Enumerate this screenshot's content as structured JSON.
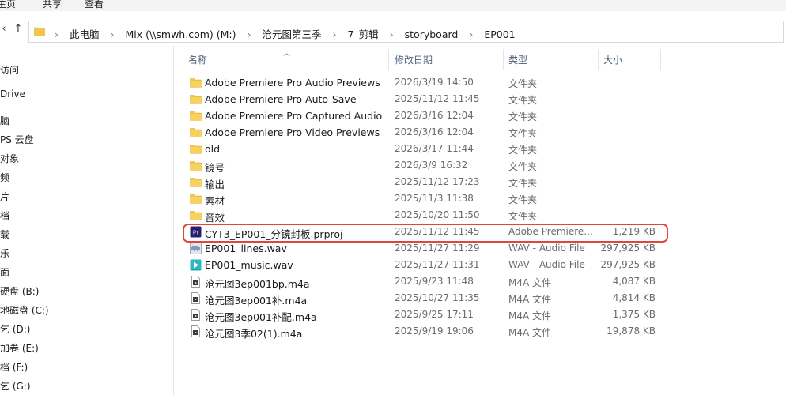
{
  "ribbon": {
    "tabs": [
      "主页",
      "共享",
      "查看"
    ]
  },
  "nav": {
    "back": "‹",
    "up": "↑"
  },
  "address": {
    "crumbs": [
      "此电脑",
      "Mix (\\\\smwh.com) (M:)",
      "沧元图第三季",
      "7_剪辑",
      "storyboard",
      "EP001"
    ],
    "separator": "›"
  },
  "sidebar": {
    "items": [
      "访问",
      "Drive",
      "脑",
      "PS 云盘",
      "对象",
      "频",
      "片",
      "档",
      "载",
      "乐",
      "面",
      "硬盘 (B:)",
      "地磁盘 (C:)",
      "乞 (D:)",
      "加卷 (E:)",
      "档 (F:)",
      "乞 (G:)"
    ]
  },
  "columns": {
    "name": "名称",
    "date": "修改日期",
    "type": "类型",
    "size": "大小"
  },
  "files": [
    {
      "icon": "folder",
      "name": "Adobe Premiere Pro Audio Previews",
      "date": "2026/3/19 14:50",
      "type": "文件夹",
      "size": ""
    },
    {
      "icon": "folder",
      "name": "Adobe Premiere Pro Auto-Save",
      "date": "2025/11/12 11:45",
      "type": "文件夹",
      "size": ""
    },
    {
      "icon": "folder",
      "name": "Adobe Premiere Pro Captured Audio",
      "date": "2026/3/16 12:04",
      "type": "文件夹",
      "size": ""
    },
    {
      "icon": "folder",
      "name": "Adobe Premiere Pro Video Previews",
      "date": "2026/3/16 12:04",
      "type": "文件夹",
      "size": ""
    },
    {
      "icon": "folder",
      "name": "old",
      "date": "2026/3/17 11:44",
      "type": "文件夹",
      "size": ""
    },
    {
      "icon": "folder",
      "name": "镜号",
      "date": "2026/3/9 16:32",
      "type": "文件夹",
      "size": ""
    },
    {
      "icon": "folder",
      "name": "输出",
      "date": "2025/11/12 17:23",
      "type": "文件夹",
      "size": ""
    },
    {
      "icon": "folder",
      "name": "素材",
      "date": "2025/11/3 11:38",
      "type": "文件夹",
      "size": ""
    },
    {
      "icon": "folder",
      "name": "音效",
      "date": "2025/10/20 11:50",
      "type": "文件夹",
      "size": ""
    },
    {
      "icon": "premiere",
      "name": "CYT3_EP001_分镜封板.prproj",
      "date": "2025/11/12 11:45",
      "type": "Adobe Premiere...",
      "size": "1,219 KB"
    },
    {
      "icon": "wav",
      "name": "EP001_lines.wav",
      "date": "2025/11/27 11:29",
      "type": "WAV - Audio File",
      "size": "297,925 KB"
    },
    {
      "icon": "wav-play",
      "name": "EP001_music.wav",
      "date": "2025/11/27 11:31",
      "type": "WAV - Audio File",
      "size": "297,925 KB"
    },
    {
      "icon": "m4a",
      "name": "沧元图3ep001bp.m4a",
      "date": "2025/9/23 11:48",
      "type": "M4A 文件",
      "size": "4,087 KB"
    },
    {
      "icon": "m4a",
      "name": "沧元图3ep001补.m4a",
      "date": "2025/10/27 11:35",
      "type": "M4A 文件",
      "size": "4,814 KB"
    },
    {
      "icon": "m4a",
      "name": "沧元图3ep001补配.m4a",
      "date": "2025/9/25 17:11",
      "type": "M4A 文件",
      "size": "1,375 KB"
    },
    {
      "icon": "m4a",
      "name": "沧元图3季02(1).m4a",
      "date": "2025/9/19 19:06",
      "type": "M4A 文件",
      "size": "19,878 KB"
    }
  ],
  "colors": {
    "highlight": "#e0473a",
    "folder": "#f4c64a",
    "premiere": "#2a1f6b",
    "header_text": "#4c607a"
  },
  "icons": {
    "folder": "folder-icon",
    "premiere": "premiere-file-icon",
    "wav": "wav-file-icon",
    "wav-play": "media-play-icon",
    "m4a": "m4a-file-icon"
  }
}
